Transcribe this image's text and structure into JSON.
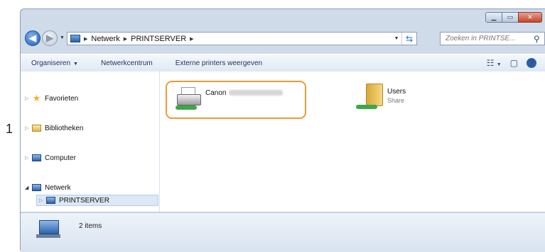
{
  "step_number": "1",
  "address": {
    "crumbs": [
      "Netwerk",
      "PRINTSERVER"
    ]
  },
  "search": {
    "placeholder": "Zoeken in PRINTSE..."
  },
  "toolbar": {
    "organize": "Organiseren",
    "network_center": "Netwerkcentrum",
    "external_printers": "Externe printers weergeven"
  },
  "nav": {
    "favorites": "Favorieten",
    "libraries": "Bibliotheken",
    "computer": "Computer",
    "network": "Netwerk",
    "printserver": "PRINTSERVER"
  },
  "content": {
    "printer_name": "Canon",
    "users_name": "Users",
    "users_type": "Share"
  },
  "details": {
    "item_count": "2 items"
  },
  "icons": [
    "back-icon",
    "forward-icon",
    "refresh-icon",
    "search-icon",
    "star-icon",
    "library-icon",
    "computer-icon",
    "network-icon",
    "printer-icon",
    "shared-folder-icon",
    "help-icon"
  ]
}
